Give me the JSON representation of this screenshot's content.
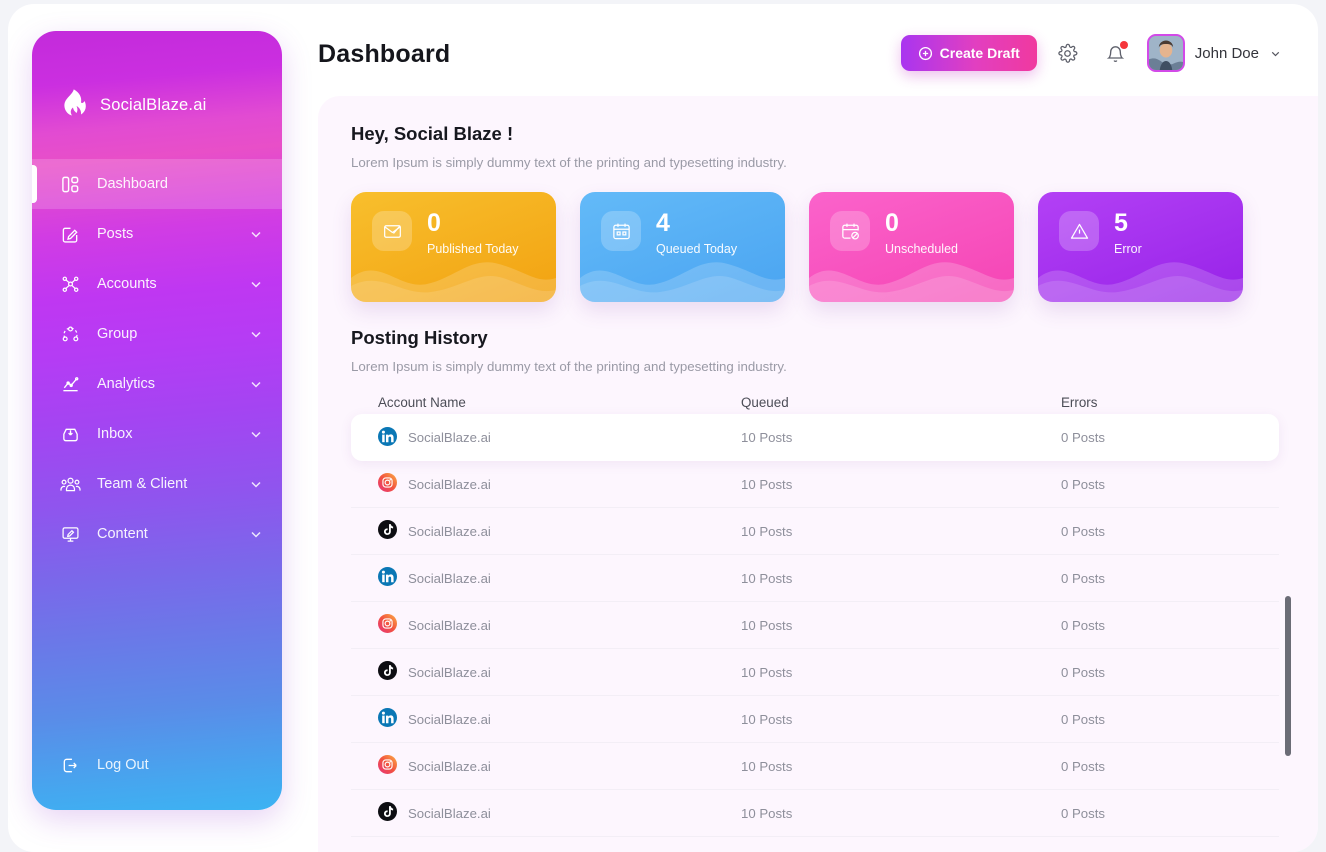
{
  "brand": {
    "name": "SocialBlaze.ai",
    "logo_icon": "flame-icon"
  },
  "sidebar": {
    "items": [
      {
        "label": "Dashboard",
        "icon": "dashboard-icon",
        "active": true,
        "chevron": false
      },
      {
        "label": "Posts",
        "icon": "edit-square-icon",
        "active": false,
        "chevron": true
      },
      {
        "label": "Accounts",
        "icon": "network-icon",
        "active": false,
        "chevron": true
      },
      {
        "label": "Group",
        "icon": "group-circle-icon",
        "active": false,
        "chevron": true
      },
      {
        "label": "Analytics",
        "icon": "chart-line-icon",
        "active": false,
        "chevron": true
      },
      {
        "label": "Inbox",
        "icon": "inbox-icon",
        "active": false,
        "chevron": true
      },
      {
        "label": "Team & Client",
        "icon": "people-icon",
        "active": false,
        "chevron": true
      },
      {
        "label": "Content",
        "icon": "monitor-edit-icon",
        "active": false,
        "chevron": true
      }
    ],
    "logout": {
      "label": "Log Out",
      "icon": "logout-icon"
    }
  },
  "header": {
    "title": "Dashboard",
    "create_draft_label": "Create Draft",
    "create_draft_icon": "plus-circle-icon",
    "settings_icon": "gear-icon",
    "notifications_icon": "bell-icon",
    "has_notification": true,
    "user_name": "John Doe",
    "user_chevron_icon": "chevron-down-icon",
    "avatar_icon": "avatar"
  },
  "greeting": {
    "title": "Hey, Social Blaze !",
    "subtitle": "Lorem Ipsum is simply dummy text of the printing and typesetting industry."
  },
  "stat_cards": [
    {
      "value": "0",
      "label": "Published Today",
      "icon": "mail-send-icon",
      "color": "#f7b924",
      "color2": "#f6a81c"
    },
    {
      "value": "4",
      "label": "Queued Today",
      "icon": "calendar-icon",
      "color": "#5ab6f6",
      "color2": "#4aa6f2"
    },
    {
      "value": "0",
      "label": "Unscheduled",
      "icon": "calendar-block-icon",
      "color": "#f955c4",
      "color2": "#f649b8"
    },
    {
      "value": "5",
      "label": "Error",
      "icon": "warning-icon",
      "color": "#a92bf0",
      "color2": "#9c26ec"
    }
  ],
  "posting_history": {
    "title": "Posting History",
    "subtitle": "Lorem Ipsum is simply dummy text of the printing and typesetting industry.",
    "columns": [
      "Account Name",
      "Queued",
      "Errors"
    ],
    "rows": [
      {
        "account": "SocialBlaze.ai",
        "network": "linkedin-icon",
        "queued": "10 Posts",
        "errors": "0 Posts"
      },
      {
        "account": "SocialBlaze.ai",
        "network": "instagram-icon",
        "queued": "10 Posts",
        "errors": "0 Posts"
      },
      {
        "account": "SocialBlaze.ai",
        "network": "tiktok-icon",
        "queued": "10 Posts",
        "errors": "0 Posts"
      },
      {
        "account": "SocialBlaze.ai",
        "network": "linkedin-icon",
        "queued": "10 Posts",
        "errors": "0 Posts"
      },
      {
        "account": "SocialBlaze.ai",
        "network": "instagram-icon",
        "queued": "10 Posts",
        "errors": "0 Posts"
      },
      {
        "account": "SocialBlaze.ai",
        "network": "tiktok-icon",
        "queued": "10 Posts",
        "errors": "0 Posts"
      },
      {
        "account": "SocialBlaze.ai",
        "network": "linkedin-icon",
        "queued": "10 Posts",
        "errors": "0 Posts"
      },
      {
        "account": "SocialBlaze.ai",
        "network": "instagram-icon",
        "queued": "10 Posts",
        "errors": "0 Posts"
      },
      {
        "account": "SocialBlaze.ai",
        "network": "tiktok-icon",
        "queued": "10 Posts",
        "errors": "0 Posts"
      }
    ]
  },
  "colors": {
    "accent_start": "#a935f0",
    "accent_end": "#f0399f",
    "sidebar_top": "#c32bdb",
    "sidebar_bottom": "#3cb3f3",
    "main_bg": "#fdf6fe"
  }
}
